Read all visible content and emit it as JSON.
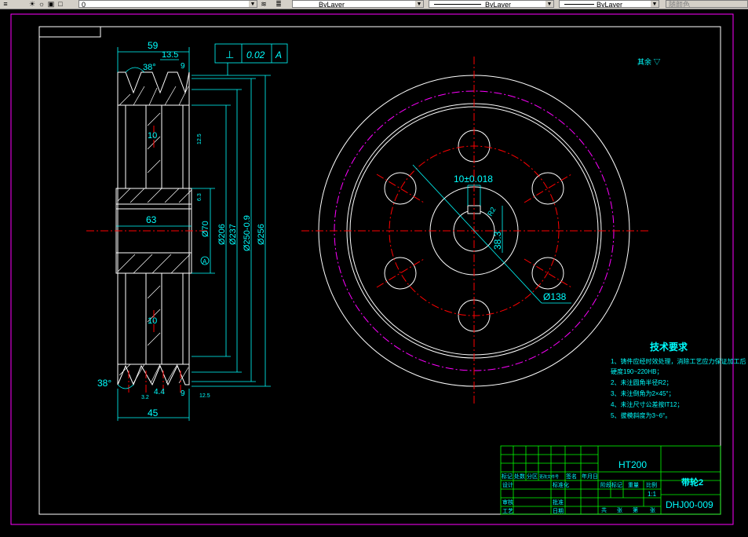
{
  "toolbar": {
    "layer_value": "0",
    "color_value": "ByLayer",
    "linetype_value": "ByLayer",
    "lineweight_value": "ByLayer",
    "plotstyle_value": "随颜色"
  },
  "drawing": {
    "section_view": {
      "dim_width_top": "59",
      "dim_groove_pitch": "13.5",
      "dim_groove_edge": "9",
      "dim_groove_angle": "38°",
      "dim_angle_bottom": "38°",
      "dim_hub_length": "63",
      "dim_web_top": "10",
      "dim_web_bottom": "10",
      "dim_overall_bottom": "45",
      "dim_bottom_small_1": "4.4",
      "dim_bottom_small_2": "9",
      "dim_d70": "Ø70",
      "dim_d206": "Ø206",
      "dim_d237": "Ø237",
      "dim_d250": "Ø250-0.9",
      "dim_d256": "Ø256",
      "tolerance_symbol": "⊥",
      "tolerance_value": "0.02",
      "tolerance_datum": "A",
      "datum_label": "A",
      "rough_12_5": "12.5",
      "rough_top": "6.3",
      "rough_bottom_left": "3.2",
      "rough_bottom_right": "12.5"
    },
    "front_view": {
      "dim_keyway": "10±0.018",
      "dim_bore": "38.3",
      "dim_bolt_circle": "Ø138",
      "dim_key_small": "R2"
    },
    "roughness_note": "其余 ▽",
    "requirements": {
      "title": "技术要求",
      "items": [
        "1、铸件应经时效处理，消除工艺应力保证加工后",
        "   硬度190~220HB；",
        "2、未注圆角半径R2；",
        "3、未注倒角为2×45°；",
        "4、未注尺寸公差按IT12；",
        "5、拔模斜度为3~6°。"
      ]
    },
    "title_block": {
      "material": "HT200",
      "part_name": "带轮2",
      "drawing_number": "DHJ00-009",
      "scale": "1:1",
      "row_labels": [
        "标记",
        "处数",
        "分区",
        "更改文件号",
        "签名",
        "年月日"
      ],
      "left_labels": [
        "设计",
        "审核",
        "工艺"
      ],
      "mid_labels": [
        "标准化",
        "批准",
        "日期"
      ],
      "stage_labels": [
        "阶段标记",
        "重量",
        "比例"
      ],
      "bottom_labels": [
        "共",
        "张",
        "第",
        "张"
      ]
    }
  },
  "colors": {
    "background": "#000000",
    "outline": "#ffffff",
    "dimension": "#00ffff",
    "center": "#ff0000",
    "pitch": "#ff00ff",
    "hatch": "#ffffff",
    "titleblock": "#00ff00",
    "text_yellow": "#ffff00"
  }
}
